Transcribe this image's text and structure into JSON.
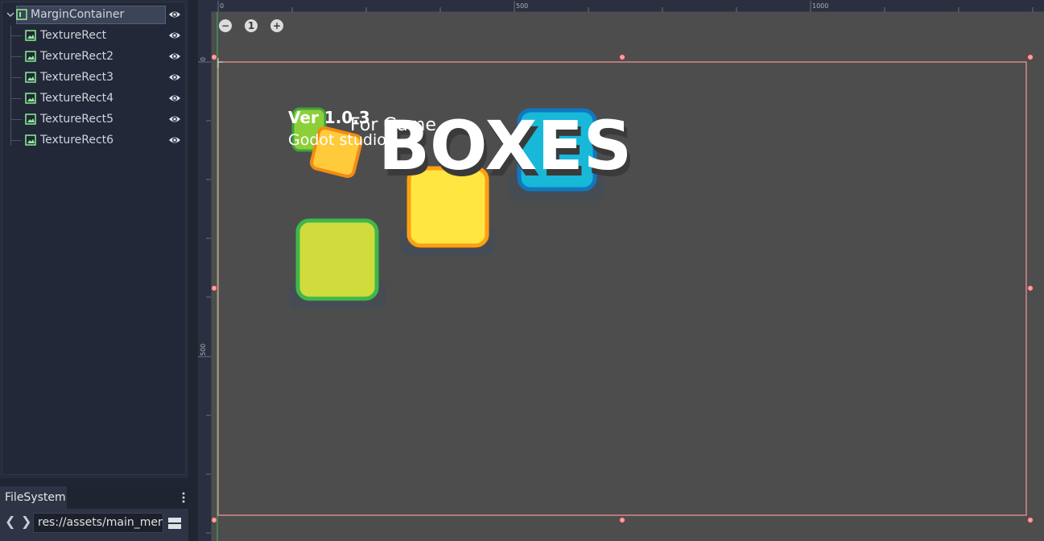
{
  "scene_tree": {
    "root": {
      "label": "MarginContainer",
      "icon": "margin-container-icon",
      "visible": true,
      "expanded": true
    },
    "children": [
      {
        "label": "TextureRect",
        "icon": "texture-rect-icon",
        "visible": true
      },
      {
        "label": "TextureRect2",
        "icon": "texture-rect-icon",
        "visible": true
      },
      {
        "label": "TextureRect3",
        "icon": "texture-rect-icon",
        "visible": true
      },
      {
        "label": "TextureRect4",
        "icon": "texture-rect-icon",
        "visible": true
      },
      {
        "label": "TextureRect5",
        "icon": "texture-rect-icon",
        "visible": true
      },
      {
        "label": "TextureRect6",
        "icon": "texture-rect-icon",
        "visible": true
      }
    ]
  },
  "filesystem": {
    "tab_label": "FileSystem",
    "path": "res://assets/main_men",
    "back_glyph": "❮",
    "forward_glyph": "❯"
  },
  "viewport": {
    "zoom_out_glyph": "−",
    "zoom_reset_label": "1",
    "zoom_in_glyph": "+",
    "ruler_top_labels": [
      "0",
      "500",
      "1000"
    ],
    "ruler_left_labels": [
      "0",
      "500"
    ],
    "canvas_text": {
      "version": "Ver 1.0.3",
      "studio": "Godot studios",
      "overlap_text": "For Game",
      "logo": "BOXES"
    },
    "colors": {
      "selection_border": "#d48a8a",
      "handle": "#f0a0a0",
      "logo_white": "#ffffff",
      "box_green": "#cfdc3c",
      "box_yellow": "#ffe640",
      "box_blue": "#18b8d8"
    }
  }
}
